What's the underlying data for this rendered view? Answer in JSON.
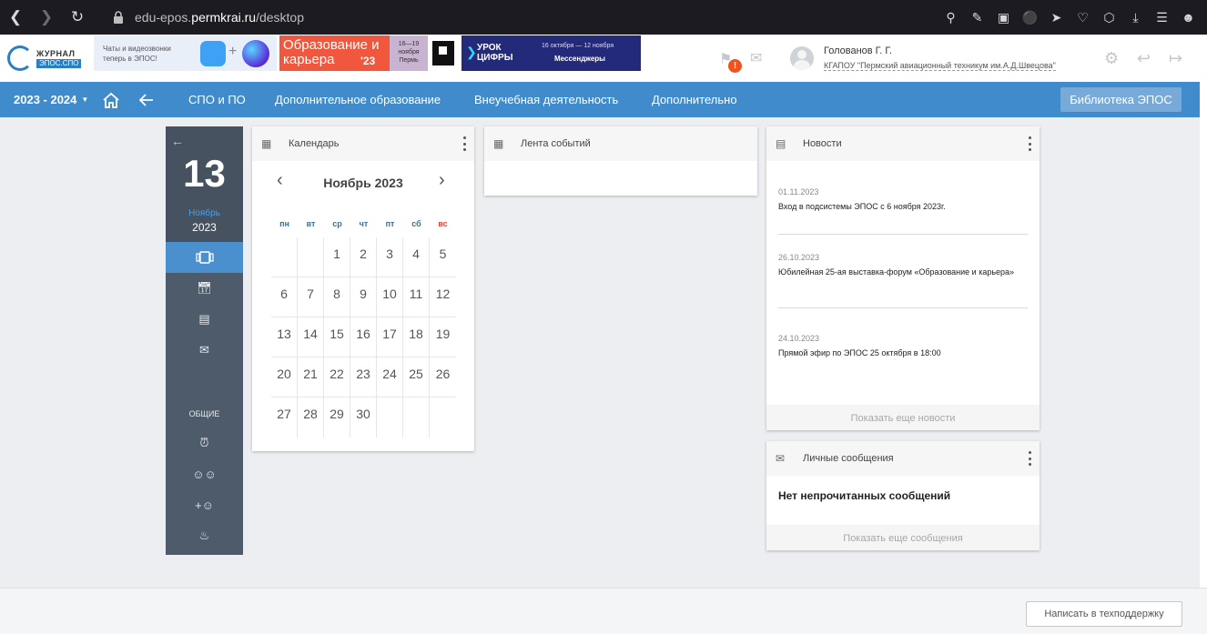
{
  "browser": {
    "url_prefix": "edu-epos.",
    "url_domain": "permkrai.ru",
    "url_path": "/desktop"
  },
  "header": {
    "logo_line1": "ЖУРНАЛ",
    "logo_line2": "ЭПОС.СПО",
    "banner_chat_text": "Чаты и видеозвонки теперь в ЭПОС!",
    "banner_edu_text": "Образование и карьера",
    "banner_edu_year": "'23",
    "banner_edu_dates": "16—19 ноября Пермь",
    "banner_cif_title": "УРОК ЦИФРЫ",
    "banner_cif_dates": "16 октября — 12 ноября",
    "banner_cif_topic": "Мессенджеры",
    "notif_count": "!",
    "user_name": "Голованов Г. Г.",
    "user_org": "КГАПОУ \"Пермский авиационный техникум им.А.Д.Швецова\""
  },
  "nav": {
    "year": "2023 - 2024",
    "links": [
      "СПО и ПО",
      "Дополнительное образование",
      "Внеучебная деятельность",
      "Дополнительно"
    ],
    "library": "Библиотека ЭПОС"
  },
  "sidebar": {
    "day": "13",
    "month": "Ноябрь",
    "year": "2023",
    "section_label": "ОБЩИЕ"
  },
  "calendar": {
    "title": "Календарь",
    "month_label": "Ноябрь 2023",
    "weekdays": [
      "пн",
      "вт",
      "ср",
      "чт",
      "пт",
      "сб",
      "вс"
    ],
    "weeks": [
      [
        "",
        "",
        "1",
        "2",
        "3",
        "4",
        "5"
      ],
      [
        "6",
        "7",
        "8",
        "9",
        "10",
        "11",
        "12"
      ],
      [
        "13",
        "14",
        "15",
        "16",
        "17",
        "18",
        "19"
      ],
      [
        "20",
        "21",
        "22",
        "23",
        "24",
        "25",
        "26"
      ],
      [
        "27",
        "28",
        "29",
        "30",
        "",
        "",
        ""
      ]
    ]
  },
  "events": {
    "title": "Лента событий"
  },
  "news": {
    "title": "Новости",
    "items": [
      {
        "date": "01.11.2023",
        "text": "Вход в подсистемы ЭПОС с 6 ноября 2023г."
      },
      {
        "date": "26.10.2023",
        "text": "Юбилейная 25-ая выставка-форум «Образование и карьера»"
      },
      {
        "date": "24.10.2023",
        "text": "Прямой эфир по ЭПОС 25 октября в 18:00"
      }
    ],
    "more": "Показать еще новости"
  },
  "messages": {
    "title": "Личные сообщения",
    "empty": "Нет непрочитанных сообщений",
    "more": "Показать еще сообщения"
  },
  "footer": {
    "support": "Написать в техподдержку"
  },
  "colors": {
    "nav_blue": "#3f8bcb",
    "sidebar": "#4d5b6a",
    "active": "#4a90cf",
    "badge": "#f2521e"
  }
}
